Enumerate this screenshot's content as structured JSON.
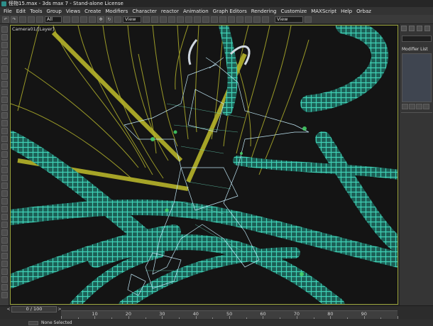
{
  "window": {
    "title": "怪物15.max - 3ds max 7 - Stand-alone License"
  },
  "menu": [
    "File",
    "Edit",
    "Tools",
    "Group",
    "Views",
    "Create",
    "Modifiers",
    "Character",
    "reactor",
    "Animation",
    "Graph Editors",
    "Rendering",
    "Customize",
    "MAXScript",
    "Help",
    "Orbaz"
  ],
  "toolbar": {
    "selection_filter": "All",
    "reference_coord": "View",
    "named_selection": "View"
  },
  "viewport": {
    "label": "Camera01/[Layer]"
  },
  "command_panel": {
    "tabs": [
      "create",
      "modify",
      "hierarchy",
      "motion",
      "display",
      "utilities"
    ],
    "modifier_list_label": "Modifier List",
    "stack_buttons": [
      "pin",
      "show-end-result",
      "make-unique",
      "remove",
      "configure"
    ]
  },
  "timeline": {
    "frame_counter": "0 / 100",
    "prev_label": "<",
    "next_label": ">",
    "ticks": [
      0,
      10,
      20,
      30,
      40,
      50,
      60,
      70,
      80,
      90,
      100
    ],
    "tick_labels": [
      "10",
      "20",
      "30",
      "40",
      "50",
      "60",
      "70",
      "80",
      "90"
    ]
  },
  "status": {
    "left_text": "None Selected"
  },
  "colors": {
    "viewport_border": "#9aa23a",
    "tentacle": "#2fb39d",
    "hair": "#a8a82a",
    "mesh": "#c8f0ff"
  }
}
